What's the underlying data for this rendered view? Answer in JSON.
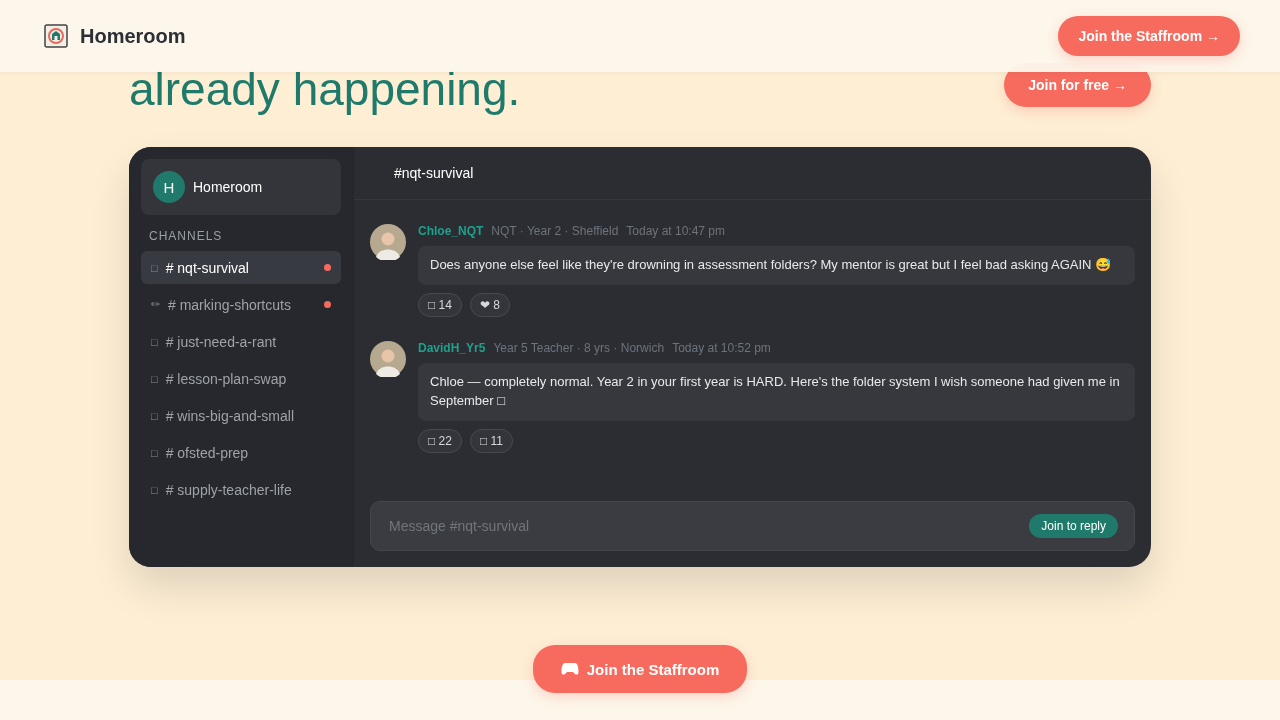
{
  "header": {
    "brand": "Homeroom",
    "cta": "Join the Staffroom →"
  },
  "hero": {
    "headline": "already happening.",
    "cta": "Join for free →"
  },
  "app": {
    "server": {
      "initial": "H",
      "name": "Homeroom"
    },
    "channels_heading": "CHANNELS",
    "channels": [
      {
        "icon": "□",
        "name": "# nqt-survival",
        "selected": true,
        "unread": true
      },
      {
        "icon": "✏",
        "name": "# marking-shortcuts",
        "selected": false,
        "unread": true
      },
      {
        "icon": "□",
        "name": "# just-need-a-rant",
        "selected": false,
        "unread": false
      },
      {
        "icon": "□",
        "name": "# lesson-plan-swap",
        "selected": false,
        "unread": false
      },
      {
        "icon": "□",
        "name": "# wins-big-and-small",
        "selected": false,
        "unread": false
      },
      {
        "icon": "□",
        "name": "# ofsted-prep",
        "selected": false,
        "unread": false
      },
      {
        "icon": "□",
        "name": "# supply-teacher-life",
        "selected": false,
        "unread": false
      }
    ],
    "channel_title": "#nqt-survival",
    "messages": [
      {
        "author": "Chloe_NQT",
        "role": "NQT · Year 2 · Sheffield",
        "time": "Today at 10:47 pm",
        "text": "Does anyone else feel like they're drowning in assessment folders? My mentor is great but I feel bad asking AGAIN 😅",
        "reactions": [
          "□ 14",
          "❤ 8"
        ]
      },
      {
        "author": "DavidH_Yr5",
        "role": "Year 5 Teacher · 8 yrs · Norwich",
        "time": "Today at 10:52 pm",
        "text": "Chloe — completely normal. Year 2 in your first year is HARD. Here's the folder system I wish someone had given me in September □",
        "reactions": [
          "□ 22",
          "□ 11"
        ]
      }
    ],
    "composer": {
      "placeholder": "Message #nqt-survival",
      "button": "Join to reply"
    }
  },
  "footer_cta": "Join the Staffroom"
}
